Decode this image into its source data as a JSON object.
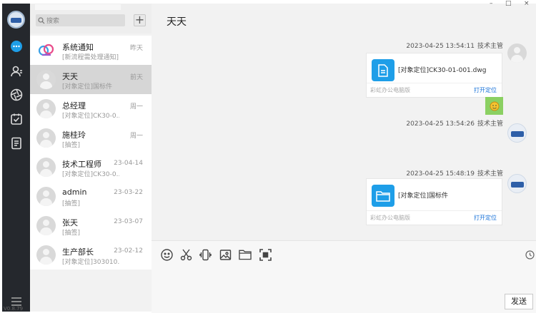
{
  "app": {
    "version": "V0.8.79"
  },
  "window": {
    "minimize": "–",
    "maximize": "□",
    "close": "×"
  },
  "sidebar": {
    "search_placeholder": "搜索",
    "add_label": "+",
    "conversations": [
      {
        "name": "系统通知",
        "preview": "[新流程需处理通知]",
        "time": "昨天",
        "avatar": "cloud-logo",
        "active": false
      },
      {
        "name": "天天",
        "preview": "[对象定位]国标件",
        "time": "前天",
        "avatar": "default",
        "active": true
      },
      {
        "name": "总经理",
        "preview": "[对象定位]CK30-0...",
        "time": "周一",
        "avatar": "default",
        "active": false
      },
      {
        "name": "施桂玲",
        "preview": "[抽签]",
        "time": "周一",
        "avatar": "default",
        "active": false
      },
      {
        "name": "技术工程师",
        "preview": "[对象定位]CK30-0...",
        "time": "23-04-14",
        "avatar": "default",
        "active": false
      },
      {
        "name": "admin",
        "preview": "[抽签]",
        "time": "23-03-22",
        "avatar": "default",
        "active": false
      },
      {
        "name": "张天",
        "preview": "[抽签]",
        "time": "23-03-07",
        "avatar": "default",
        "active": false
      },
      {
        "name": "生产部长",
        "preview": "[对象定位]303010...",
        "time": "23-02-12",
        "avatar": "default",
        "active": false
      }
    ]
  },
  "chat": {
    "title": "天天",
    "messages": [
      {
        "timestamp": "2023-04-25 13:54:11",
        "sender": "技术主管",
        "type": "file",
        "file_name": "[对象定位]CK30-01-001.dwg",
        "file_icon": "document-icon",
        "source": "彩虹办公电脑版",
        "action": "打开定位"
      },
      {
        "timestamp": "2023-04-25 13:54:26",
        "sender": "技术主管",
        "type": "emoji",
        "content": "emoji"
      },
      {
        "timestamp": "2023-04-25 15:48:19",
        "sender": "技术主管",
        "type": "file",
        "file_name": "[对象定位]国标件",
        "file_icon": "folder-icon",
        "source": "彩虹办公电脑版",
        "action": "打开定位"
      }
    ]
  },
  "composer": {
    "tools": [
      "emoji-icon",
      "scissors-icon",
      "shake-icon",
      "image-icon",
      "folder-icon",
      "screenshot-icon"
    ],
    "history_icon": "clock-icon",
    "send_label": "发送"
  },
  "colors": {
    "rail": "#25282d",
    "accent": "#1e9ee8",
    "link": "#1a73d9",
    "emoji_bg": "#8bd062"
  }
}
